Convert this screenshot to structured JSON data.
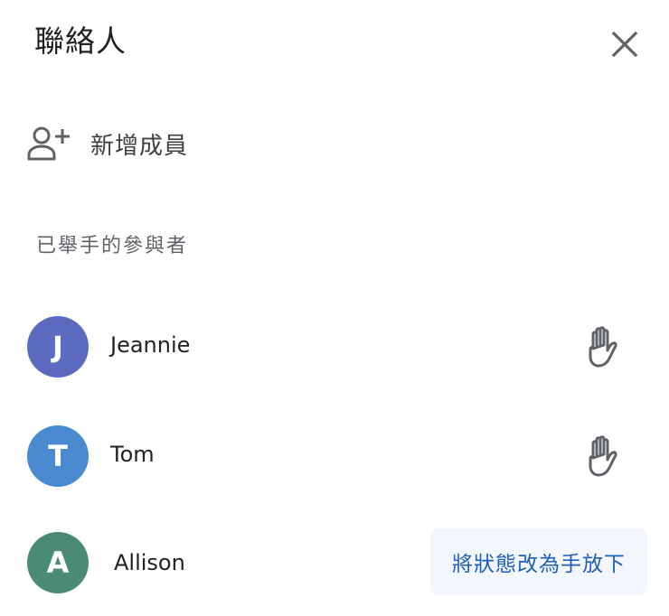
{
  "header": {
    "title": "聯絡人",
    "close_icon": "close-icon"
  },
  "add_member": {
    "label": "新增成員",
    "icon": "person-add-icon"
  },
  "section": {
    "label": "已舉手的參與者"
  },
  "participants": [
    {
      "initial": "J",
      "name": "Jeannie",
      "avatar_color": "#5c6bc0",
      "action_icon": "raised-hand-icon"
    },
    {
      "initial": "T",
      "name": "Tom",
      "avatar_color": "#4a8ad0",
      "action_icon": "raised-hand-icon"
    },
    {
      "initial": "A",
      "name": "Allison",
      "avatar_color": "#4a8a76",
      "action_label": "將狀態改為手放下"
    }
  ],
  "colors": {
    "accent": "#1f5fb8",
    "lower_button_bg": "#f3f7fd",
    "icon_gray": "#5f6368"
  }
}
